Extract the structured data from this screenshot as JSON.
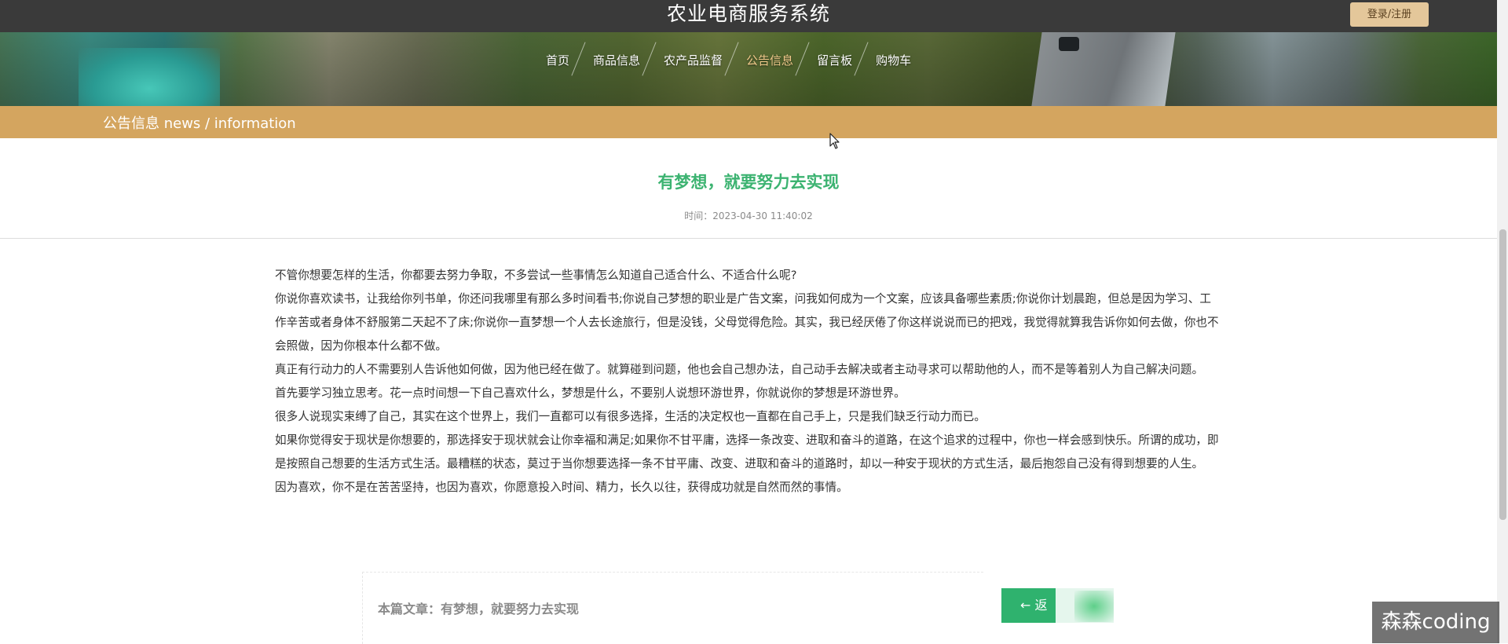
{
  "header": {
    "site_title": "农业电商服务系统",
    "login_label": "登录/注册"
  },
  "nav": {
    "items": [
      {
        "label": "首页"
      },
      {
        "label": "商品信息"
      },
      {
        "label": "农产品监督"
      },
      {
        "label": "公告信息"
      },
      {
        "label": "留言板"
      },
      {
        "label": "购物车"
      }
    ],
    "active_label": "公告信息"
  },
  "section": {
    "title": "公告信息  news / information"
  },
  "article": {
    "title": "有梦想，就要努力去实现",
    "time": "时间：2023-04-30 11:40:02",
    "paragraphs": [
      "不管你想要怎样的生活，你都要去努力争取，不多尝试一些事情怎么知道自己适合什么、不适合什么呢?",
      "你说你喜欢读书，让我给你列书单，你还问我哪里有那么多时间看书;你说自己梦想的职业是广告文案，问我如何成为一个文案，应该具备哪些素质;你说你计划晨跑，但总是因为学习、工作辛苦或者身体不舒服第二天起不了床;你说你一直梦想一个人去长途旅行，但是没钱，父母觉得危险。其实，我已经厌倦了你这样说说而已的把戏，我觉得就算我告诉你如何去做，你也不会照做，因为你根本什么都不做。",
      "真正有行动力的人不需要别人告诉他如何做，因为他已经在做了。就算碰到问题，他也会自己想办法，自己动手去解决或者主动寻求可以帮助他的人，而不是等着别人为自己解决问题。",
      "首先要学习独立思考。花一点时间想一下自己喜欢什么，梦想是什么，不要别人说想环游世界，你就说你的梦想是环游世界。",
      "很多人说现实束缚了自己，其实在这个世界上，我们一直都可以有很多选择，生活的决定权也一直都在自己手上，只是我们缺乏行动力而已。",
      "如果你觉得安于现状是你想要的，那选择安于现状就会让你幸福和满足;如果你不甘平庸，选择一条改变、进取和奋斗的道路，在这个追求的过程中，你也一样会感到快乐。所谓的成功，即是按照自己想要的生活方式生活。最糟糕的状态，莫过于当你想要选择一条不甘平庸、改变、进取和奋斗的道路时，却以一种安于现状的方式生活，最后抱怨自己没有得到想要的人生。",
      "因为喜欢，你不是在苦苦坚持，也因为喜欢，你愿意投入时间、精力，长久以往，获得成功就是自然而然的事情。"
    ]
  },
  "footer": {
    "current_article_label": "本篇文章：有梦想，就要努力去实现",
    "back_button_label": "← 返"
  },
  "watermark": {
    "text": "森森coding"
  },
  "colors": {
    "topbar": "#3a3a3a",
    "accent_gold": "#d4a55f",
    "title_green": "#3cb371",
    "button_green": "#2fb26e",
    "login_bg": "#e4c79a"
  }
}
